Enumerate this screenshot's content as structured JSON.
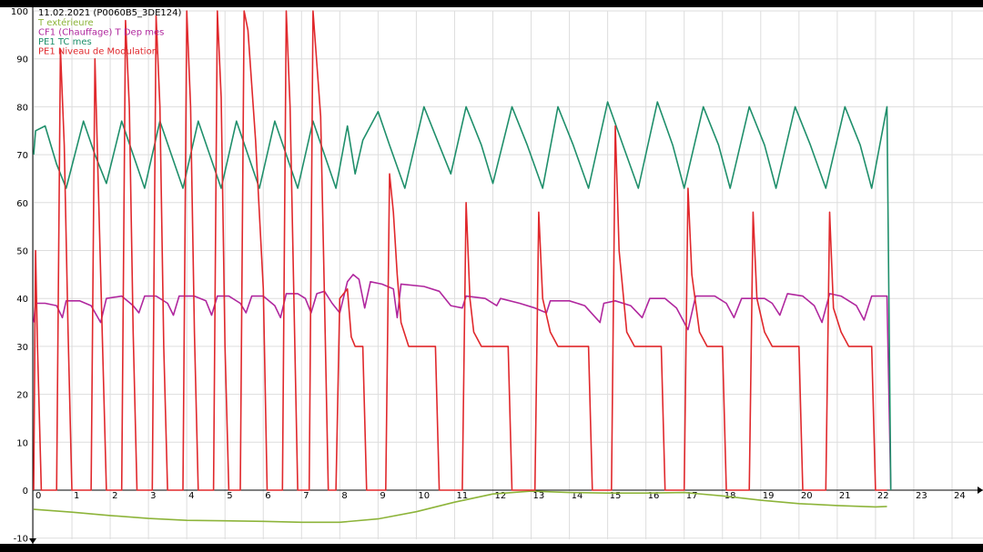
{
  "header": {
    "title": "11.02.2021 (P0060B5_3DE124)"
  },
  "chart_data": {
    "type": "line",
    "title": "11.02.2021 (P0060B5_3DE124)",
    "xlabel": "",
    "ylabel": "",
    "xlim": [
      0,
      24.3
    ],
    "ylim": [
      -10,
      100
    ],
    "x_ticks": [
      "0",
      "1",
      "2",
      "3",
      "4",
      "5",
      "6",
      "7",
      "8",
      "9",
      "10",
      "11",
      "12",
      "13",
      "14",
      "15",
      "16",
      "17",
      "18",
      "19",
      "20",
      "21",
      "22",
      "23",
      "24"
    ],
    "y_ticks": [
      "-10",
      "0",
      "10",
      "20",
      "30",
      "40",
      "50",
      "60",
      "70",
      "80",
      "90",
      "100"
    ],
    "grid": true,
    "legend_position": "top-left",
    "series": [
      {
        "name": "T extérieure",
        "color": "#8db43a",
        "points": [
          [
            0,
            -4
          ],
          [
            1,
            -4.6
          ],
          [
            2,
            -5.3
          ],
          [
            3,
            -5.9
          ],
          [
            4,
            -6.3
          ],
          [
            5,
            -6.4
          ],
          [
            6,
            -6.5
          ],
          [
            7,
            -6.7
          ],
          [
            8,
            -6.7
          ],
          [
            9,
            -6
          ],
          [
            10,
            -4.5
          ],
          [
            11,
            -2.5
          ],
          [
            12,
            -0.8
          ],
          [
            13,
            -0.2
          ],
          [
            14,
            -0.5
          ],
          [
            15,
            -0.6
          ],
          [
            16,
            -0.6
          ],
          [
            17,
            -0.5
          ],
          [
            18,
            -1.2
          ],
          [
            19,
            -2.1
          ],
          [
            20,
            -2.8
          ],
          [
            21,
            -3.2
          ],
          [
            22,
            -3.5
          ],
          [
            22.3,
            -3.4
          ]
        ]
      },
      {
        "name": "CF1 (Chauffage) T Dep mes",
        "color": "#b0279e",
        "points": [
          [
            0,
            35
          ],
          [
            0.05,
            39
          ],
          [
            0.3,
            39
          ],
          [
            0.6,
            38.5
          ],
          [
            0.75,
            36
          ],
          [
            0.85,
            39.5
          ],
          [
            1.2,
            39.5
          ],
          [
            1.5,
            38.5
          ],
          [
            1.75,
            35
          ],
          [
            1.9,
            40
          ],
          [
            2.3,
            40.5
          ],
          [
            2.6,
            38.5
          ],
          [
            2.75,
            37
          ],
          [
            2.9,
            40.5
          ],
          [
            3.2,
            40.5
          ],
          [
            3.5,
            39
          ],
          [
            3.65,
            36.5
          ],
          [
            3.8,
            40.5
          ],
          [
            4.2,
            40.5
          ],
          [
            4.5,
            39.5
          ],
          [
            4.65,
            36.5
          ],
          [
            4.8,
            40.5
          ],
          [
            5.1,
            40.5
          ],
          [
            5.4,
            39
          ],
          [
            5.55,
            37
          ],
          [
            5.7,
            40.5
          ],
          [
            6.0,
            40.5
          ],
          [
            6.3,
            38.5
          ],
          [
            6.45,
            36
          ],
          [
            6.6,
            41
          ],
          [
            6.9,
            41
          ],
          [
            7.1,
            40
          ],
          [
            7.25,
            37
          ],
          [
            7.4,
            41
          ],
          [
            7.6,
            41.5
          ],
          [
            7.8,
            39
          ],
          [
            8.0,
            37
          ],
          [
            8.2,
            43.5
          ],
          [
            8.35,
            45
          ],
          [
            8.5,
            44
          ],
          [
            8.65,
            38
          ],
          [
            8.8,
            43.5
          ],
          [
            9.1,
            43
          ],
          [
            9.4,
            42
          ],
          [
            9.5,
            36
          ],
          [
            9.6,
            43
          ],
          [
            10.2,
            42.5
          ],
          [
            10.6,
            41.5
          ],
          [
            10.9,
            38.5
          ],
          [
            11.2,
            38
          ],
          [
            11.3,
            40.5
          ],
          [
            11.8,
            40
          ],
          [
            12.1,
            38.5
          ],
          [
            12.2,
            40
          ],
          [
            12.7,
            39
          ],
          [
            13.1,
            38
          ],
          [
            13.4,
            37
          ],
          [
            13.5,
            39.5
          ],
          [
            14,
            39.5
          ],
          [
            14.4,
            38.5
          ],
          [
            14.8,
            35
          ],
          [
            14.9,
            39
          ],
          [
            15.2,
            39.5
          ],
          [
            15.6,
            38.5
          ],
          [
            15.9,
            36
          ],
          [
            16.1,
            40
          ],
          [
            16.5,
            40
          ],
          [
            16.8,
            38
          ],
          [
            17.1,
            33.5
          ],
          [
            17.3,
            40.5
          ],
          [
            17.8,
            40.5
          ],
          [
            18.1,
            39
          ],
          [
            18.3,
            36
          ],
          [
            18.5,
            40
          ],
          [
            18.8,
            40
          ],
          [
            19.1,
            40
          ],
          [
            19.3,
            39
          ],
          [
            19.5,
            36.5
          ],
          [
            19.7,
            41
          ],
          [
            20.1,
            40.5
          ],
          [
            20.4,
            38.5
          ],
          [
            20.6,
            35
          ],
          [
            20.8,
            41
          ],
          [
            21.1,
            40.5
          ],
          [
            21.5,
            38.5
          ],
          [
            21.7,
            35.5
          ],
          [
            21.9,
            40.5
          ],
          [
            22.3,
            40.5
          ],
          [
            22.4,
            0
          ]
        ]
      },
      {
        "name": "PE1 TC mes",
        "color": "#1f8f6b",
        "points": [
          [
            0,
            70
          ],
          [
            0.05,
            75
          ],
          [
            0.3,
            76
          ],
          [
            0.6,
            68
          ],
          [
            0.85,
            63
          ],
          [
            1.3,
            77
          ],
          [
            1.6,
            70
          ],
          [
            1.9,
            64
          ],
          [
            2.3,
            77
          ],
          [
            2.6,
            70
          ],
          [
            2.9,
            63
          ],
          [
            3.3,
            77
          ],
          [
            3.6,
            70
          ],
          [
            3.9,
            63
          ],
          [
            4.3,
            77
          ],
          [
            4.6,
            70
          ],
          [
            4.9,
            63
          ],
          [
            5.3,
            77
          ],
          [
            5.6,
            70
          ],
          [
            5.9,
            63
          ],
          [
            6.3,
            77
          ],
          [
            6.6,
            70
          ],
          [
            6.9,
            63
          ],
          [
            7.3,
            77
          ],
          [
            7.6,
            70
          ],
          [
            7.9,
            63
          ],
          [
            8.2,
            76
          ],
          [
            8.4,
            66
          ],
          [
            8.6,
            73
          ],
          [
            9.0,
            79
          ],
          [
            9.3,
            72
          ],
          [
            9.7,
            63
          ],
          [
            10.2,
            80
          ],
          [
            10.6,
            72
          ],
          [
            10.9,
            66
          ],
          [
            11.3,
            80
          ],
          [
            11.7,
            72
          ],
          [
            12.0,
            64
          ],
          [
            12.5,
            80
          ],
          [
            12.9,
            72
          ],
          [
            13.3,
            63
          ],
          [
            13.7,
            80
          ],
          [
            14.1,
            72
          ],
          [
            14.5,
            63
          ],
          [
            15.0,
            81
          ],
          [
            15.4,
            72
          ],
          [
            15.8,
            63
          ],
          [
            16.3,
            81
          ],
          [
            16.7,
            72
          ],
          [
            17.0,
            63
          ],
          [
            17.5,
            80
          ],
          [
            17.9,
            72
          ],
          [
            18.2,
            63
          ],
          [
            18.7,
            80
          ],
          [
            19.1,
            72
          ],
          [
            19.4,
            63
          ],
          [
            19.9,
            80
          ],
          [
            20.3,
            72
          ],
          [
            20.7,
            63
          ],
          [
            21.2,
            80
          ],
          [
            21.6,
            72
          ],
          [
            21.9,
            63
          ],
          [
            22.3,
            80
          ],
          [
            22.4,
            0
          ]
        ]
      },
      {
        "name": "PE1 Niveau de Modulation",
        "color": "#e0282c",
        "points": [
          [
            0,
            0
          ],
          [
            0.05,
            50
          ],
          [
            0.1,
            30
          ],
          [
            0.2,
            0
          ],
          [
            0.6,
            0
          ],
          [
            0.7,
            92
          ],
          [
            0.8,
            72
          ],
          [
            0.9,
            33
          ],
          [
            1.0,
            0
          ],
          [
            1.5,
            0
          ],
          [
            1.6,
            90
          ],
          [
            1.7,
            60
          ],
          [
            1.8,
            30
          ],
          [
            1.9,
            0
          ],
          [
            2.3,
            0
          ],
          [
            2.4,
            98
          ],
          [
            2.5,
            80
          ],
          [
            2.6,
            33
          ],
          [
            2.7,
            0
          ],
          [
            3.1,
            0
          ],
          [
            3.2,
            99
          ],
          [
            3.3,
            80
          ],
          [
            3.4,
            30
          ],
          [
            3.5,
            0
          ],
          [
            3.9,
            0
          ],
          [
            4.0,
            100
          ],
          [
            4.1,
            80
          ],
          [
            4.2,
            33
          ],
          [
            4.3,
            0
          ],
          [
            4.7,
            0
          ],
          [
            4.8,
            100
          ],
          [
            4.9,
            82
          ],
          [
            5.0,
            30
          ],
          [
            5.1,
            0
          ],
          [
            5.4,
            0
          ],
          [
            5.5,
            100
          ],
          [
            5.6,
            96
          ],
          [
            5.8,
            73
          ],
          [
            6.0,
            42
          ],
          [
            6.1,
            0
          ],
          [
            6.5,
            0
          ],
          [
            6.6,
            100
          ],
          [
            6.7,
            80
          ],
          [
            6.8,
            40
          ],
          [
            6.9,
            0
          ],
          [
            7.2,
            0
          ],
          [
            7.3,
            100
          ],
          [
            7.5,
            78
          ],
          [
            7.6,
            40
          ],
          [
            7.7,
            0
          ],
          [
            7.9,
            0
          ],
          [
            8.0,
            40
          ],
          [
            8.2,
            42
          ],
          [
            8.3,
            32
          ],
          [
            8.4,
            30
          ],
          [
            8.6,
            30
          ],
          [
            8.7,
            0
          ],
          [
            9.2,
            0
          ],
          [
            9.3,
            66
          ],
          [
            9.4,
            58
          ],
          [
            9.5,
            45
          ],
          [
            9.6,
            35
          ],
          [
            9.8,
            30
          ],
          [
            10.5,
            30
          ],
          [
            10.6,
            0
          ],
          [
            11.2,
            0
          ],
          [
            11.3,
            60
          ],
          [
            11.4,
            40
          ],
          [
            11.5,
            33
          ],
          [
            11.7,
            30
          ],
          [
            12.4,
            30
          ],
          [
            12.5,
            0
          ],
          [
            13.1,
            0
          ],
          [
            13.2,
            58
          ],
          [
            13.3,
            40
          ],
          [
            13.5,
            33
          ],
          [
            13.7,
            30
          ],
          [
            14.5,
            30
          ],
          [
            14.6,
            0
          ],
          [
            15.1,
            0
          ],
          [
            15.2,
            76
          ],
          [
            15.3,
            50
          ],
          [
            15.5,
            33
          ],
          [
            15.7,
            30
          ],
          [
            16.4,
            30
          ],
          [
            16.5,
            0
          ],
          [
            17.0,
            0
          ],
          [
            17.1,
            63
          ],
          [
            17.2,
            45
          ],
          [
            17.4,
            33
          ],
          [
            17.6,
            30
          ],
          [
            18.0,
            30
          ],
          [
            18.1,
            0
          ],
          [
            18.7,
            0
          ],
          [
            18.8,
            58
          ],
          [
            18.9,
            40
          ],
          [
            19.1,
            33
          ],
          [
            19.3,
            30
          ],
          [
            20.0,
            30
          ],
          [
            20.1,
            0
          ],
          [
            20.7,
            0
          ],
          [
            20.8,
            58
          ],
          [
            20.9,
            38
          ],
          [
            21.1,
            33
          ],
          [
            21.3,
            30
          ],
          [
            21.9,
            30
          ],
          [
            22.0,
            0
          ],
          [
            22.3,
            0
          ]
        ]
      }
    ]
  }
}
